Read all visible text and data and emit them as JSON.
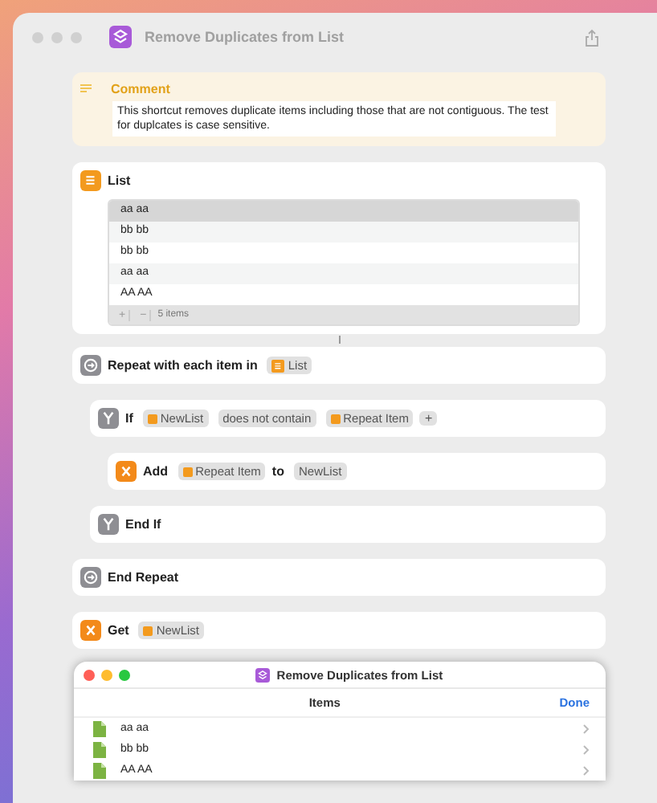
{
  "window": {
    "title": "Remove Duplicates from List"
  },
  "comment": {
    "title": "Comment",
    "text": "This shortcut removes duplicate items including those that are not contiguous. The test for duplcates is case sensitive."
  },
  "list_action": {
    "title": "List",
    "items": [
      {
        "text": "aa aa",
        "selected": true
      },
      {
        "text": "bb bb",
        "selected": false
      },
      {
        "text": "bb bb",
        "selected": false
      },
      {
        "text": "aa aa",
        "selected": false
      },
      {
        "text": "AA AA",
        "selected": false
      }
    ],
    "add": "+",
    "remove": "−",
    "count": "5 items"
  },
  "steps": [
    {
      "kind": "repeat",
      "tokens": [
        {
          "kind": "label",
          "text": "Repeat with each item in"
        },
        {
          "kind": "list",
          "text": "List"
        }
      ],
      "children": [
        {
          "kind": "if",
          "tokens": [
            {
              "kind": "label",
              "text": "If"
            },
            {
              "kind": "variable",
              "text": "NewList"
            },
            {
              "kind": "parameter",
              "text": "does not contain"
            },
            {
              "kind": "variable",
              "text": "Repeat Item"
            },
            {
              "kind": "add",
              "text": "+"
            }
          ],
          "children": [
            {
              "kind": "variable",
              "tokens": [
                {
                  "kind": "label",
                  "text": "Add"
                },
                {
                  "kind": "variable",
                  "text": "Repeat Item"
                },
                {
                  "kind": "label",
                  "text": "to"
                },
                {
                  "kind": "parameter",
                  "text": "NewList"
                }
              ]
            }
          ]
        },
        {
          "kind": "if",
          "tokens": [
            {
              "kind": "label",
              "text": "End If"
            }
          ]
        }
      ]
    },
    {
      "kind": "repeat",
      "tokens": [
        {
          "kind": "label",
          "text": "End Repeat"
        }
      ]
    },
    {
      "kind": "variable",
      "tokens": [
        {
          "kind": "label",
          "text": "Get"
        },
        {
          "kind": "variable",
          "text": "NewList"
        }
      ]
    }
  ],
  "result_window": {
    "title": "Remove Duplicates from List",
    "header": "Items",
    "done": "Done",
    "items": [
      "aa aa",
      "bb bb",
      "AA AA"
    ]
  }
}
